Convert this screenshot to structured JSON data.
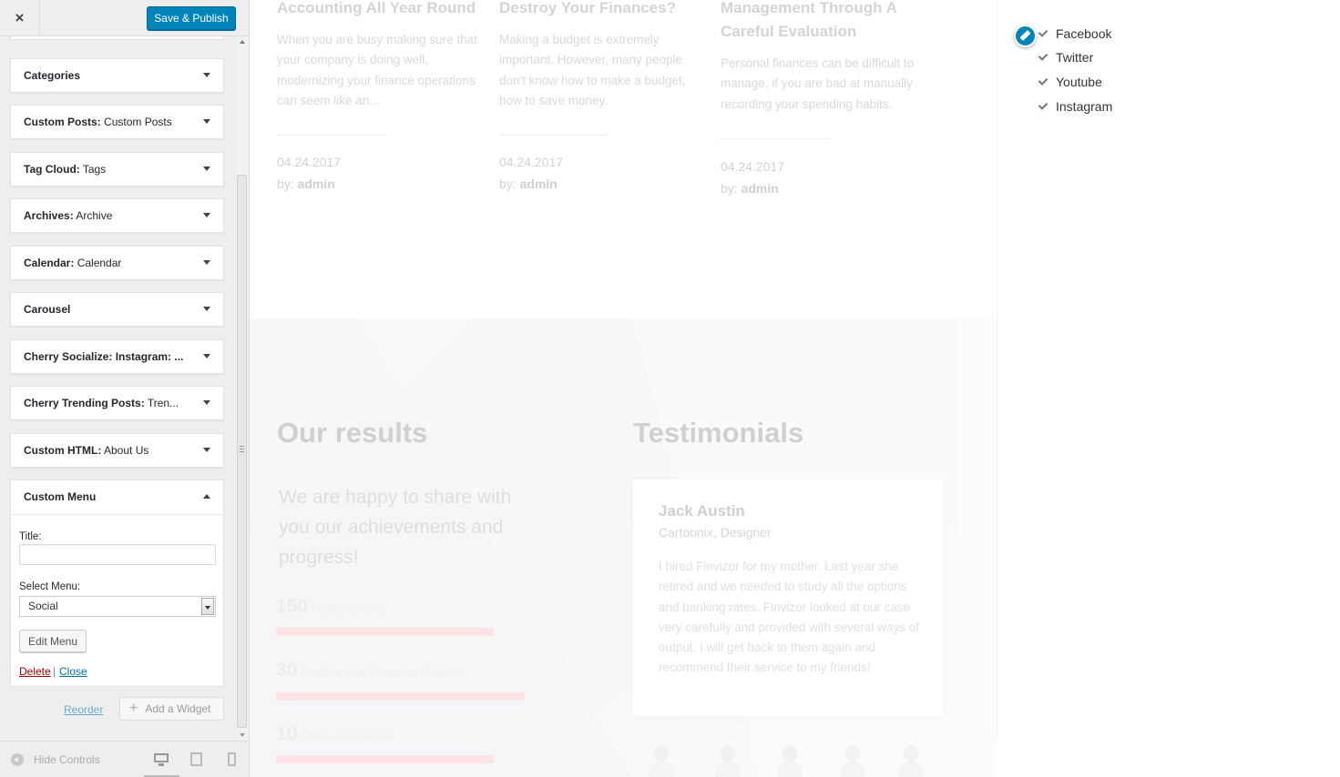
{
  "header": {
    "close_icon": "×",
    "publish_label": "Save & Publish"
  },
  "widgets": [
    {
      "title": "Categories",
      "sub": ""
    },
    {
      "title": "Custom Posts:",
      "sub": " Custom Posts"
    },
    {
      "title": "Tag Cloud:",
      "sub": " Tags"
    },
    {
      "title": "Archives:",
      "sub": " Archive"
    },
    {
      "title": "Calendar:",
      "sub": " Calendar"
    },
    {
      "title": "Carousel",
      "sub": ""
    },
    {
      "title": "Cherry Socialize: Instagram: ...",
      "sub": ""
    },
    {
      "title": "Cherry Trending Posts:",
      "sub": " Tren..."
    },
    {
      "title": "Custom HTML:",
      "sub": " About Us"
    }
  ],
  "custom_menu": {
    "title": "Custom Menu",
    "title_label": "Title:",
    "title_value": "",
    "select_label": "Select Menu:",
    "select_value": "Social",
    "edit_menu_label": "Edit Menu",
    "delete_label": "Delete",
    "separator": "|",
    "close_label": "Close"
  },
  "sidebar_actions": {
    "reorder_label": "Reorder",
    "add_widget_label": "Add a Widget"
  },
  "footer": {
    "hide_controls_label": "Hide Controls"
  },
  "preview": {
    "posts": [
      {
        "title": "Accounting All Year Round",
        "excerpt": "When you are busy making sure that your company is doing well, modernizing your finance operations can seem like an...",
        "date": "04.24.2017",
        "by": "by:",
        "author": "admin"
      },
      {
        "title": "Destroy Your Finances?",
        "excerpt": "Making a budget is extremely important. However, many people don't know how to make a budget, how to save money.",
        "date": "04.24.2017",
        "by": "by:",
        "author": "admin"
      },
      {
        "title": "Management Through A Careful Evaluation",
        "excerpt": "Personal finances can be difficult to manage, if you are bad at manually recording your spending habits.",
        "date": "04.24.2017",
        "by": "by:",
        "author": "admin"
      }
    ],
    "results": {
      "title": "Our results",
      "subtitle": "We are happy to share with you our achievements and progress!",
      "stats": [
        {
          "num": "150",
          "label": "Happy Clients",
          "fill": 0.5
        },
        {
          "num": "30",
          "label": "Professional Financial Advisors",
          "fill": 0.57
        },
        {
          "num": "10",
          "label": "Years Experience",
          "fill": 0.5
        }
      ]
    },
    "testimonials": {
      "title": "Testimonials",
      "name": "Jack Austin",
      "role": "Cartoonix, Designer",
      "quote": "I hired Finvizor for my mother. Last year she retired and we needed to study all the options and banking rates. Finvizor looked at our case very carefully and provided with several ways of output. I will get back to them again and recommend their service to my friends!"
    },
    "social_menu": [
      "Facebook",
      "Twitter",
      "Youtube",
      "Instagram"
    ]
  },
  "colors": {
    "primary": "#0085ba",
    "delete": "#aa0000",
    "link": "#0073aa",
    "progress": "#fde3e3"
  },
  "icons": {
    "close": "close-icon",
    "dropdown": "triangle-down-icon",
    "collapse": "triangle-up-icon",
    "add": "plus-icon",
    "hide_controls": "circle-arrow-left-icon",
    "desktop": "desktop-icon",
    "tablet": "tablet-icon",
    "mobile": "mobile-icon",
    "edit_shortcut": "pencil-icon",
    "social_check": "checkmark-icon"
  }
}
